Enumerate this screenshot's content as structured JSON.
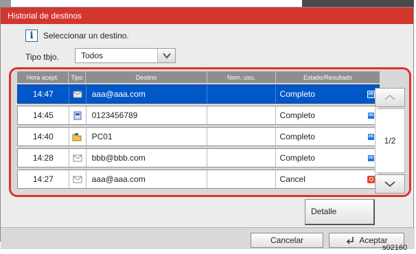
{
  "window": {
    "title": "Historial de destinos"
  },
  "info": {
    "message": "Seleccionar un destino."
  },
  "filter": {
    "label": "Tipo tbjo.",
    "value": "Todos"
  },
  "table": {
    "headers": [
      "Hora acept.",
      "Tipo",
      "Destino",
      "Nom. usu.",
      "Estado/Resultado"
    ],
    "rows": [
      {
        "time": "14:47",
        "type_icon": "email-icon",
        "dest": "aaa@aaa.com",
        "user": "",
        "status": "Completo",
        "result_icon": "ok-icon"
      },
      {
        "time": "14:45",
        "type_icon": "fax-icon",
        "dest": "0123456789",
        "user": "",
        "status": "Completo",
        "result_icon": "ok-icon"
      },
      {
        "time": "14:40",
        "type_icon": "folder-icon",
        "dest": "PC01",
        "user": "",
        "status": "Completo",
        "result_icon": "ok-icon"
      },
      {
        "time": "14:28",
        "type_icon": "email-icon",
        "dest": "bbb@bbb.com",
        "user": "",
        "status": "Completo",
        "result_icon": "ok-icon"
      },
      {
        "time": "14:27",
        "type_icon": "email-icon",
        "dest": "aaa@aaa.com",
        "user": "",
        "status": "Cancel",
        "result_icon": "cancel-icon"
      }
    ]
  },
  "pager": {
    "indicator": "1/2"
  },
  "buttons": {
    "detail": "Detalle",
    "cancel": "Cancelar",
    "accept": "Aceptar"
  },
  "figure_ref": "s02160",
  "colors": {
    "titlebar": "#d2362f",
    "selection": "#0058c8",
    "highlight_frame": "#e03030"
  }
}
